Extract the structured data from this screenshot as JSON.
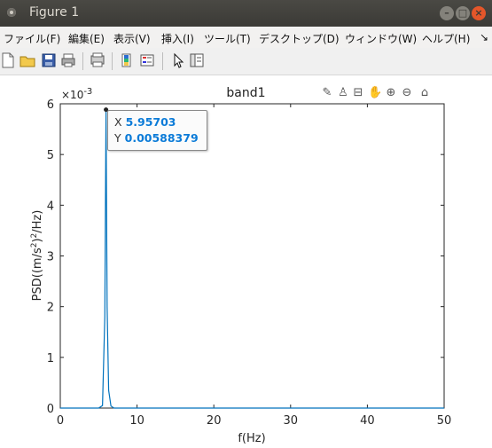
{
  "window": {
    "title": "Figure 1"
  },
  "menu": [
    "ファイル(F)",
    "編集(E)",
    "表示(V)",
    "挿入(I)",
    "ツール(T)",
    "デスクトップ(D)",
    "ウィンドウ(W)",
    "ヘルプ(H)"
  ],
  "menu_overflow": "↘",
  "axes": {
    "title": "band1",
    "xlabel": "f(Hz)",
    "ylabel_main": "PSD((m/s",
    "ylabel_sup1": "2",
    "ylabel_mid": ")",
    "ylabel_sup2": "2",
    "ylabel_end": "/Hz)",
    "exponent_base": "×10",
    "exponent_power": "-3",
    "xticks": [
      "0",
      "10",
      "20",
      "30",
      "40",
      "50"
    ],
    "yticks": [
      "0",
      "1",
      "2",
      "3",
      "4",
      "5",
      "6"
    ]
  },
  "datatip": {
    "x_label": "X",
    "x_value": "5.95703",
    "y_label": "Y",
    "y_value": "0.00588379"
  },
  "colors": {
    "line": "#0072bd",
    "datatip_value": "#0b7bd8"
  },
  "chart_data": {
    "type": "line",
    "title": "band1",
    "xlabel": "f(Hz)",
    "ylabel": "PSD((m/s2)2/Hz)",
    "xlim": [
      0,
      50
    ],
    "ylim": [
      0,
      0.006
    ],
    "x": [
      0,
      5.0,
      5.5,
      5.8,
      5.95703,
      6.1,
      6.3,
      6.6,
      7.0,
      50
    ],
    "y": [
      0,
      0.0,
      5e-05,
      0.0018,
      0.00588379,
      0.002,
      0.00035,
      4e-05,
      0.0,
      0.0
    ],
    "datatip": {
      "x": 5.95703,
      "y": 0.00588379
    }
  }
}
